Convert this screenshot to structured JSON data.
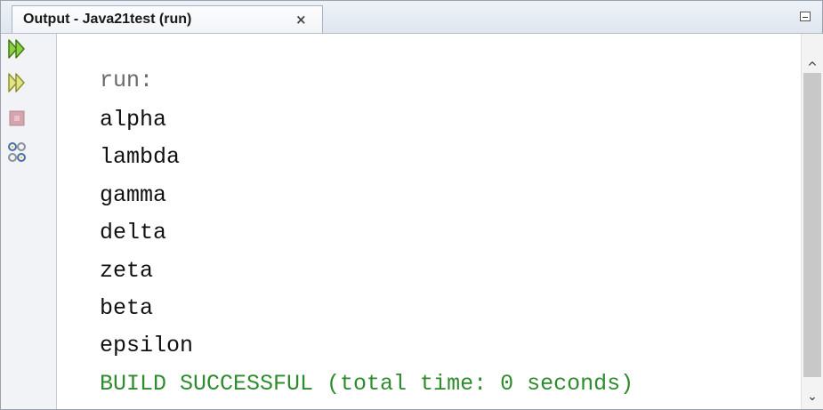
{
  "tab": {
    "title": "Output - Java21test (run)",
    "close_glyph": "×"
  },
  "toolbar": {
    "tools": [
      {
        "icon": "rerun-icon"
      },
      {
        "icon": "rerun-with-options-icon"
      },
      {
        "icon": "stop-icon"
      },
      {
        "icon": "settings-icon"
      }
    ]
  },
  "output": {
    "lines": [
      "run:",
      "alpha",
      "lambda",
      "gamma",
      "delta",
      "zeta",
      "beta",
      "epsilon",
      "BUILD SUCCESSFUL (total time: 0 seconds)"
    ]
  },
  "scrollbar": {
    "up_glyph": "^",
    "down_glyph": "⌄"
  },
  "colors": {
    "success_text": "#2e8b2e",
    "dim_text": "#6a6a6a",
    "rerun_green": "#6fb62a"
  }
}
